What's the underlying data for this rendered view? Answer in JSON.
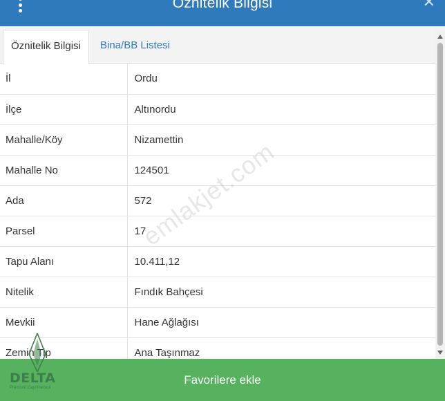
{
  "header": {
    "title": "Öznitelik Bilgisi",
    "menu_icon": "vertical-dots-icon",
    "close_icon": "close-x-icon"
  },
  "tabs": [
    {
      "label": "Öznitelik Bilgisi",
      "active": true
    },
    {
      "label": "Bina/BB Listesi",
      "active": false
    }
  ],
  "rows": [
    {
      "label": "İl",
      "value": "Ordu"
    },
    {
      "label": "İlçe",
      "value": "Altınordu"
    },
    {
      "label": "Mahalle/Köy",
      "value": "Nizamettin"
    },
    {
      "label": "Mahalle No",
      "value": "124501"
    },
    {
      "label": "Ada",
      "value": "572"
    },
    {
      "label": "Parsel",
      "value": "17"
    },
    {
      "label": "Tapu Alanı",
      "value": "10.411,12"
    },
    {
      "label": "Nitelik",
      "value": "Fındık Bahçesi"
    },
    {
      "label": "Mevkii",
      "value": "Hane Ağlağısı"
    },
    {
      "label": "Zemin Tip",
      "value": "Ana Taşınmaz"
    }
  ],
  "footer": {
    "button_label": "Favorilere ekle"
  },
  "watermark": {
    "text": "emlakjet.com"
  },
  "logo": {
    "name": "DELTA",
    "subtitle": "Premium Gayrimenkul"
  },
  "colors": {
    "header": "#2f79bd",
    "footer": "#57b25f",
    "link": "#2f79bd"
  }
}
